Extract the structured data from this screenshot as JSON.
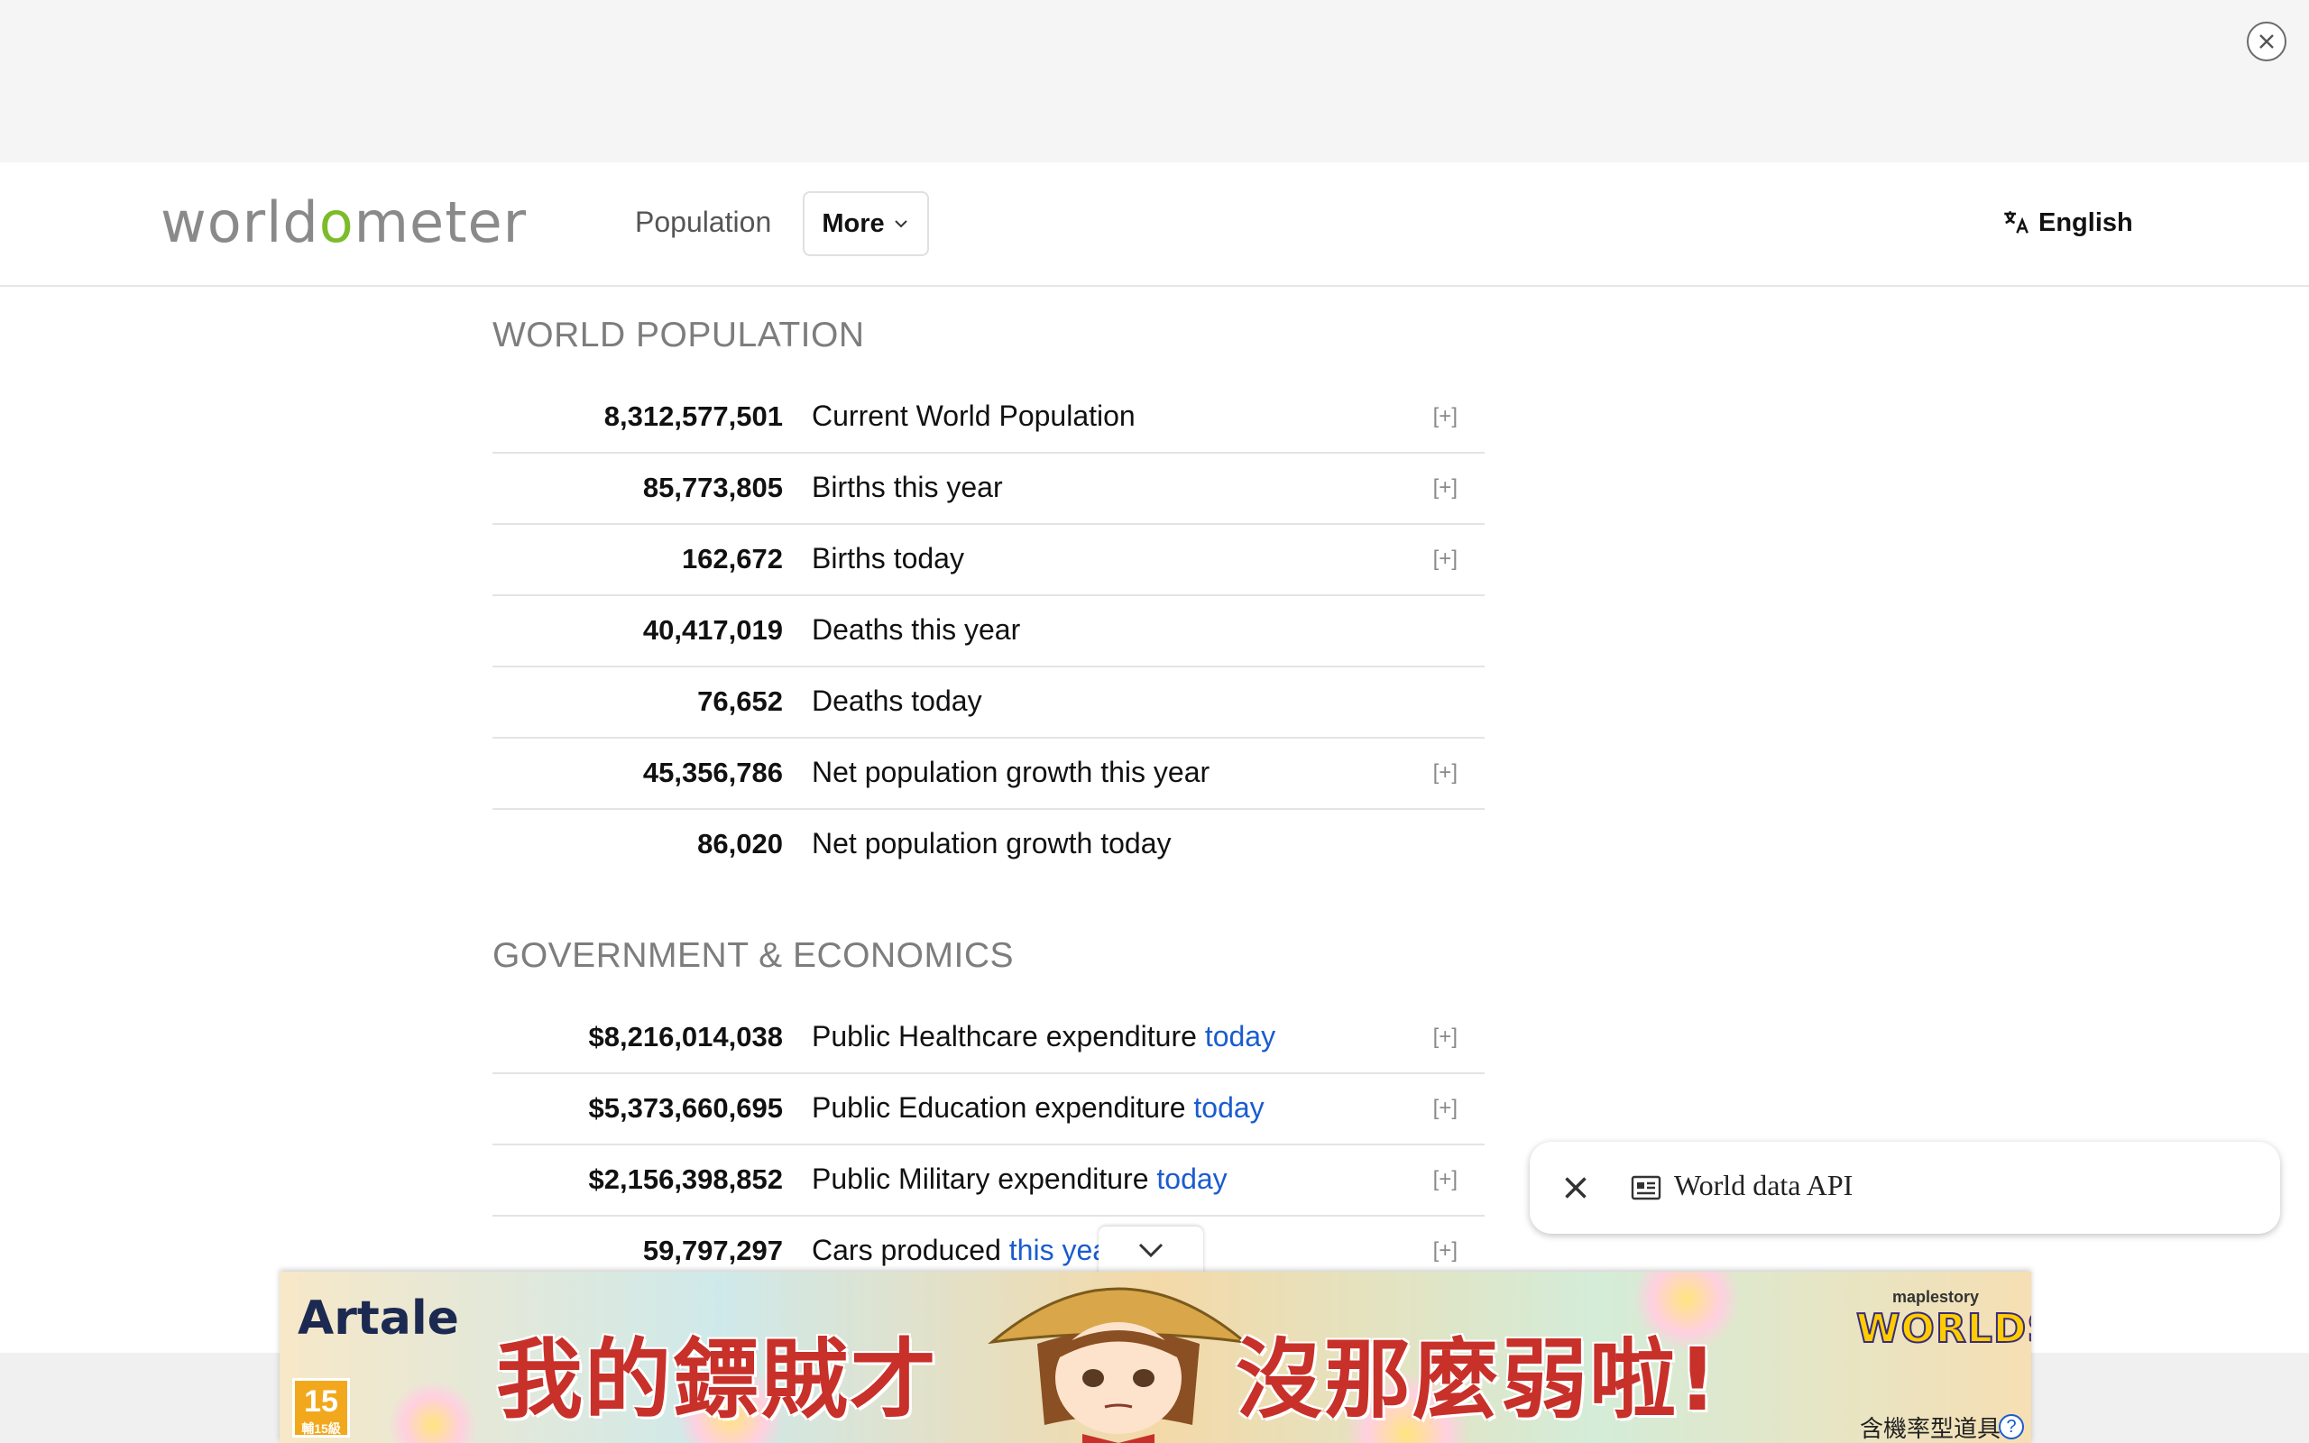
{
  "top_ad_close": {
    "icon": "close-circle-icon"
  },
  "header": {
    "logo": {
      "part1": "world",
      "o": "o",
      "part2": "meter"
    },
    "nav": {
      "population": "Population",
      "more": "More"
    },
    "language": "English"
  },
  "world_population": {
    "title": "WORLD POPULATION",
    "rows": [
      {
        "value": "8,312,577,501",
        "label": "Current World Population",
        "link": "",
        "expand": "[+]"
      },
      {
        "value": "85,773,805",
        "label": "Births this year",
        "link": "",
        "expand": "[+]"
      },
      {
        "value": "162,672",
        "label": "Births today",
        "link": "",
        "expand": "[+]"
      },
      {
        "value": "40,417,019",
        "label": "Deaths this year",
        "link": "",
        "expand": ""
      },
      {
        "value": "76,652",
        "label": "Deaths today",
        "link": "",
        "expand": ""
      },
      {
        "value": "45,356,786",
        "label": "Net population growth this year",
        "link": "",
        "expand": "[+]"
      },
      {
        "value": "86,020",
        "label": "Net population growth today",
        "link": "",
        "expand": ""
      }
    ]
  },
  "government": {
    "title": "GOVERNMENT & ECONOMICS",
    "rows": [
      {
        "value": "$8,216,014,038",
        "label": "Public Healthcare expenditure ",
        "link": "today",
        "expand": "[+]"
      },
      {
        "value": "$5,373,660,695",
        "label": "Public Education expenditure ",
        "link": "today",
        "expand": "[+]"
      },
      {
        "value": "$2,156,398,852",
        "label": "Public Military expenditure ",
        "link": "today",
        "expand": "[+]"
      },
      {
        "value": "59,797,297",
        "label": "Cars produced ",
        "link": "this yea",
        "expand": "[+]"
      }
    ]
  },
  "api_popup": {
    "label": "World data API",
    "close_icon": "close-icon",
    "icon": "newspaper-icon"
  },
  "bottom_ad": {
    "brand": "Artale",
    "rating": "15",
    "rating_sub": "輔15級",
    "headline_left": "我的鏢賊才",
    "headline_right": "沒那麼弱啦!",
    "partner_small": "maplestory",
    "partner_big": "WORLDS",
    "note": "含機率型道具",
    "help": "?",
    "collapse_icon": "chevron-down-icon"
  }
}
